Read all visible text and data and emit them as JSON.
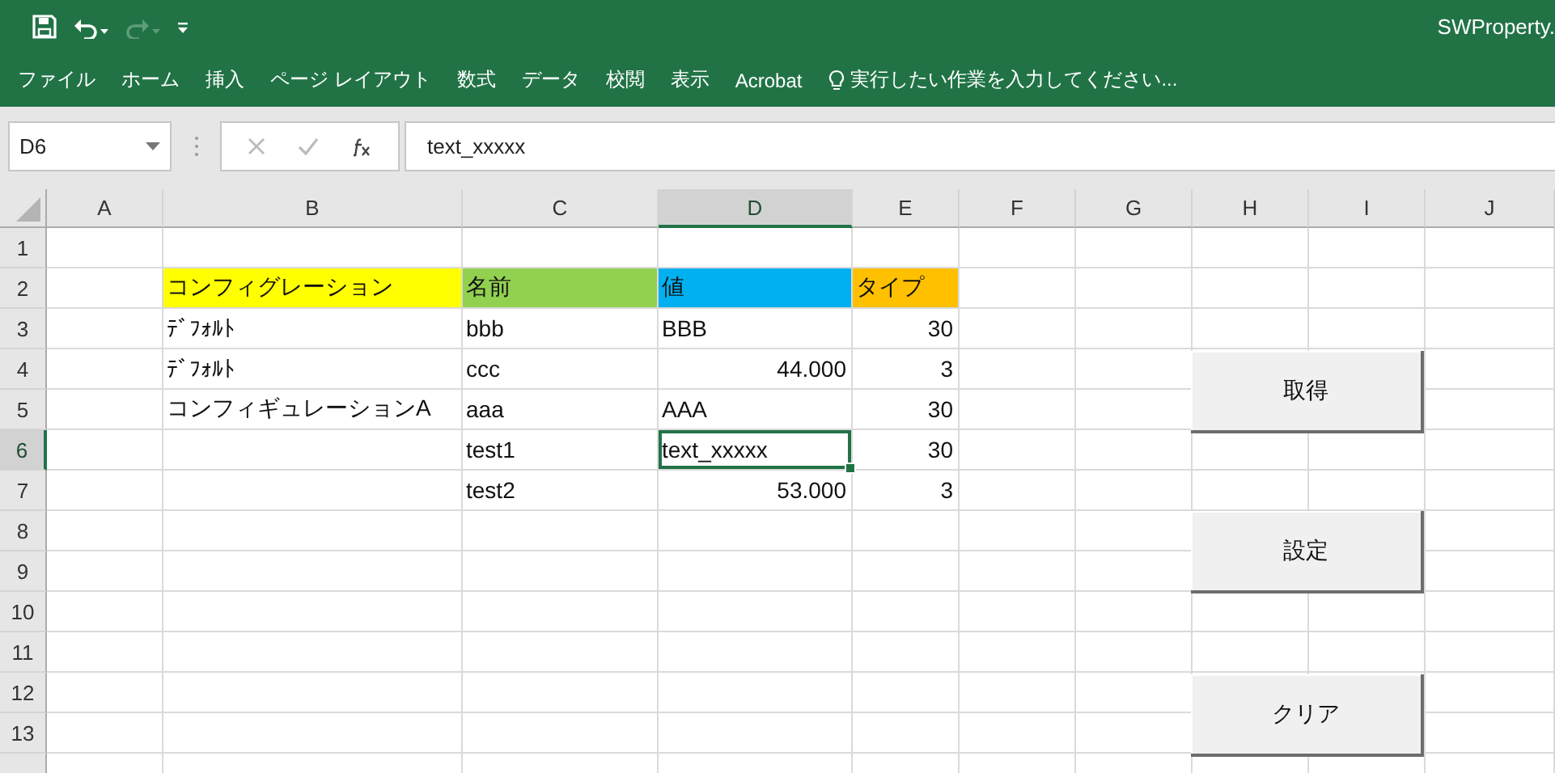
{
  "window": {
    "title": "SWProperty."
  },
  "quick_access": [
    {
      "kind": "save",
      "disabled": false
    },
    {
      "kind": "undo",
      "disabled": false
    },
    {
      "kind": "redo",
      "disabled": true
    },
    {
      "kind": "customize",
      "disabled": false
    }
  ],
  "ribbon_tabs": [
    "ファイル",
    "ホーム",
    "挿入",
    "ページ レイアウト",
    "数式",
    "データ",
    "校閲",
    "表示",
    "Acrobat"
  ],
  "tell_me": {
    "placeholder": "実行したい作業を入力してください..."
  },
  "formula_bar": {
    "name_box": "D6",
    "value": "text_xxxxx"
  },
  "columns": [
    {
      "label": "A",
      "selected": false
    },
    {
      "label": "B",
      "selected": false
    },
    {
      "label": "C",
      "selected": false
    },
    {
      "label": "D",
      "selected": true
    },
    {
      "label": "E",
      "selected": false
    },
    {
      "label": "F",
      "selected": false
    },
    {
      "label": "G",
      "selected": false
    },
    {
      "label": "H",
      "selected": false
    },
    {
      "label": "I",
      "selected": false
    },
    {
      "label": "J",
      "selected": false
    }
  ],
  "rows": [
    {
      "label": "1",
      "selected": false
    },
    {
      "label": "2",
      "selected": false,
      "cells": [
        null,
        {
          "text": "コンフィグレーション",
          "kind": "text",
          "color": "#ffff00"
        },
        {
          "text": "名前",
          "kind": "text",
          "color": "#92d050"
        },
        {
          "text": "値",
          "kind": "text",
          "color": "#00b0f0"
        },
        {
          "text": "タイプ",
          "kind": "text",
          "color": "#ffc000"
        }
      ]
    },
    {
      "label": "3",
      "selected": false,
      "cells": [
        null,
        {
          "text": "ﾃﾞﾌｫﾙﾄ",
          "kind": "text"
        },
        {
          "text": "bbb",
          "kind": "text"
        },
        {
          "text": "BBB",
          "kind": "text"
        },
        {
          "text": "30",
          "kind": "number"
        }
      ]
    },
    {
      "label": "4",
      "selected": false,
      "cells": [
        null,
        {
          "text": "ﾃﾞﾌｫﾙﾄ",
          "kind": "text"
        },
        {
          "text": "ccc",
          "kind": "text"
        },
        {
          "text": "44.000",
          "kind": "number"
        },
        {
          "text": "3",
          "kind": "number"
        }
      ]
    },
    {
      "label": "5",
      "selected": false,
      "cells": [
        null,
        {
          "text": " コンフィギュレーションA",
          "kind": "text"
        },
        {
          "text": "aaa",
          "kind": "text"
        },
        {
          "text": "AAA",
          "kind": "text"
        },
        {
          "text": "30",
          "kind": "number"
        }
      ]
    },
    {
      "label": "6",
      "selected": true,
      "cells": [
        null,
        null,
        {
          "text": "test1",
          "kind": "text"
        },
        {
          "text": "text_xxxxx",
          "kind": "text"
        },
        {
          "text": "30",
          "kind": "number"
        }
      ]
    },
    {
      "label": "7",
      "selected": false,
      "cells": [
        null,
        null,
        {
          "text": "test2",
          "kind": "text"
        },
        {
          "text": "53.000",
          "kind": "number"
        },
        {
          "text": "3",
          "kind": "number"
        }
      ]
    },
    {
      "label": "8",
      "selected": false
    },
    {
      "label": "9",
      "selected": false
    },
    {
      "label": "10",
      "selected": false
    },
    {
      "label": "11",
      "selected": false
    },
    {
      "label": "12",
      "selected": false
    },
    {
      "label": "13",
      "selected": false
    },
    {
      "selected": false
    }
  ],
  "buttons": [
    "取得",
    "設定",
    "クリア"
  ]
}
